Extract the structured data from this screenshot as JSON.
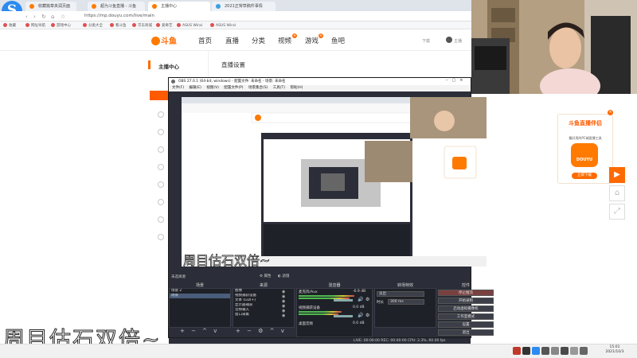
{
  "browser": {
    "logo_letter": "S",
    "tabs": [
      {
        "label": "收藏篇章夹润页面"
      },
      {
        "label": "超为斗鱼直播 - 斗鱼"
      },
      {
        "label": "主播中心"
      },
      {
        "label": "2021正常草稿件事情"
      }
    ],
    "url": "https://mp.douyu.com/live/main",
    "bookmarks": [
      "收藏",
      "网址导航",
      "游戏中心",
      "分类大全",
      "看斗鱼",
      "京东商城",
      "爱奇艺",
      "ASUS Wiral",
      "ASUS Wiral"
    ]
  },
  "douyu": {
    "logo": "斗鱼",
    "nav": [
      "首页",
      "直播",
      "分类",
      "视频",
      "游戏",
      "鱼吧"
    ],
    "nav_hot": "H",
    "header_right": [
      "下载",
      "主播"
    ],
    "sidebar_title": "主播中心",
    "content_title": "直播设置"
  },
  "obs": {
    "title": "OBS 27.0.1 (64-bit, windows) - 配置文件: 未命名 - 场景: 未命名",
    "menu": "文件(F) 编辑(E) 视图(V) 配置文件(P) 场景集合(S) 工具(T) 帮助(H)",
    "no_source": "未选择源",
    "props_btn": "属性",
    "filter_btn": "滤镜",
    "docks": {
      "scenes": "场景",
      "sources": "来源",
      "mixer": "混音器",
      "transitions": "转场特效",
      "controls": "控件"
    },
    "scene_items": [
      "场景 2",
      "场景"
    ],
    "source_items": [
      "图像",
      "视频捕获设备",
      "文本 (GDI+)",
      "显示器捕获",
      "音频输入",
      "窗口采集"
    ],
    "mixer_items": [
      {
        "name": "麦克风/Aux",
        "db": "-6.9 dB"
      },
      {
        "name": "视频捕获设备",
        "db": "0.0 dB"
      },
      {
        "name": "桌面音频",
        "db": "0.0 dB"
      }
    ],
    "transition_value": "淡出",
    "duration_label": "时长",
    "duration_value": "300 ms",
    "controls": [
      "停止推流",
      "开始录制",
      "启动虚拟摄像机",
      "工作室模式",
      "设置",
      "退出"
    ],
    "status": "LIVE: 00:00:00   REC: 00:00:00   CPU: 2.3%, 60.00 fps"
  },
  "rank_card": {
    "title": "斗鱼直播伴侣",
    "subtitle": "最好用的PC端直播工具",
    "app_label": "DOUYU",
    "button": "立即下载",
    "close": "×"
  },
  "float_buttons": [
    "▶",
    "⌂",
    "⤢"
  ],
  "subtitle_text": "周目估石双倍~",
  "taskbar": {
    "time": "15:01",
    "date": "2021/10/3"
  },
  "colors": {
    "douyu_orange": "#ff6a00",
    "obs_bg": "#2b2e38",
    "browser_blue": "#2c8af0"
  }
}
